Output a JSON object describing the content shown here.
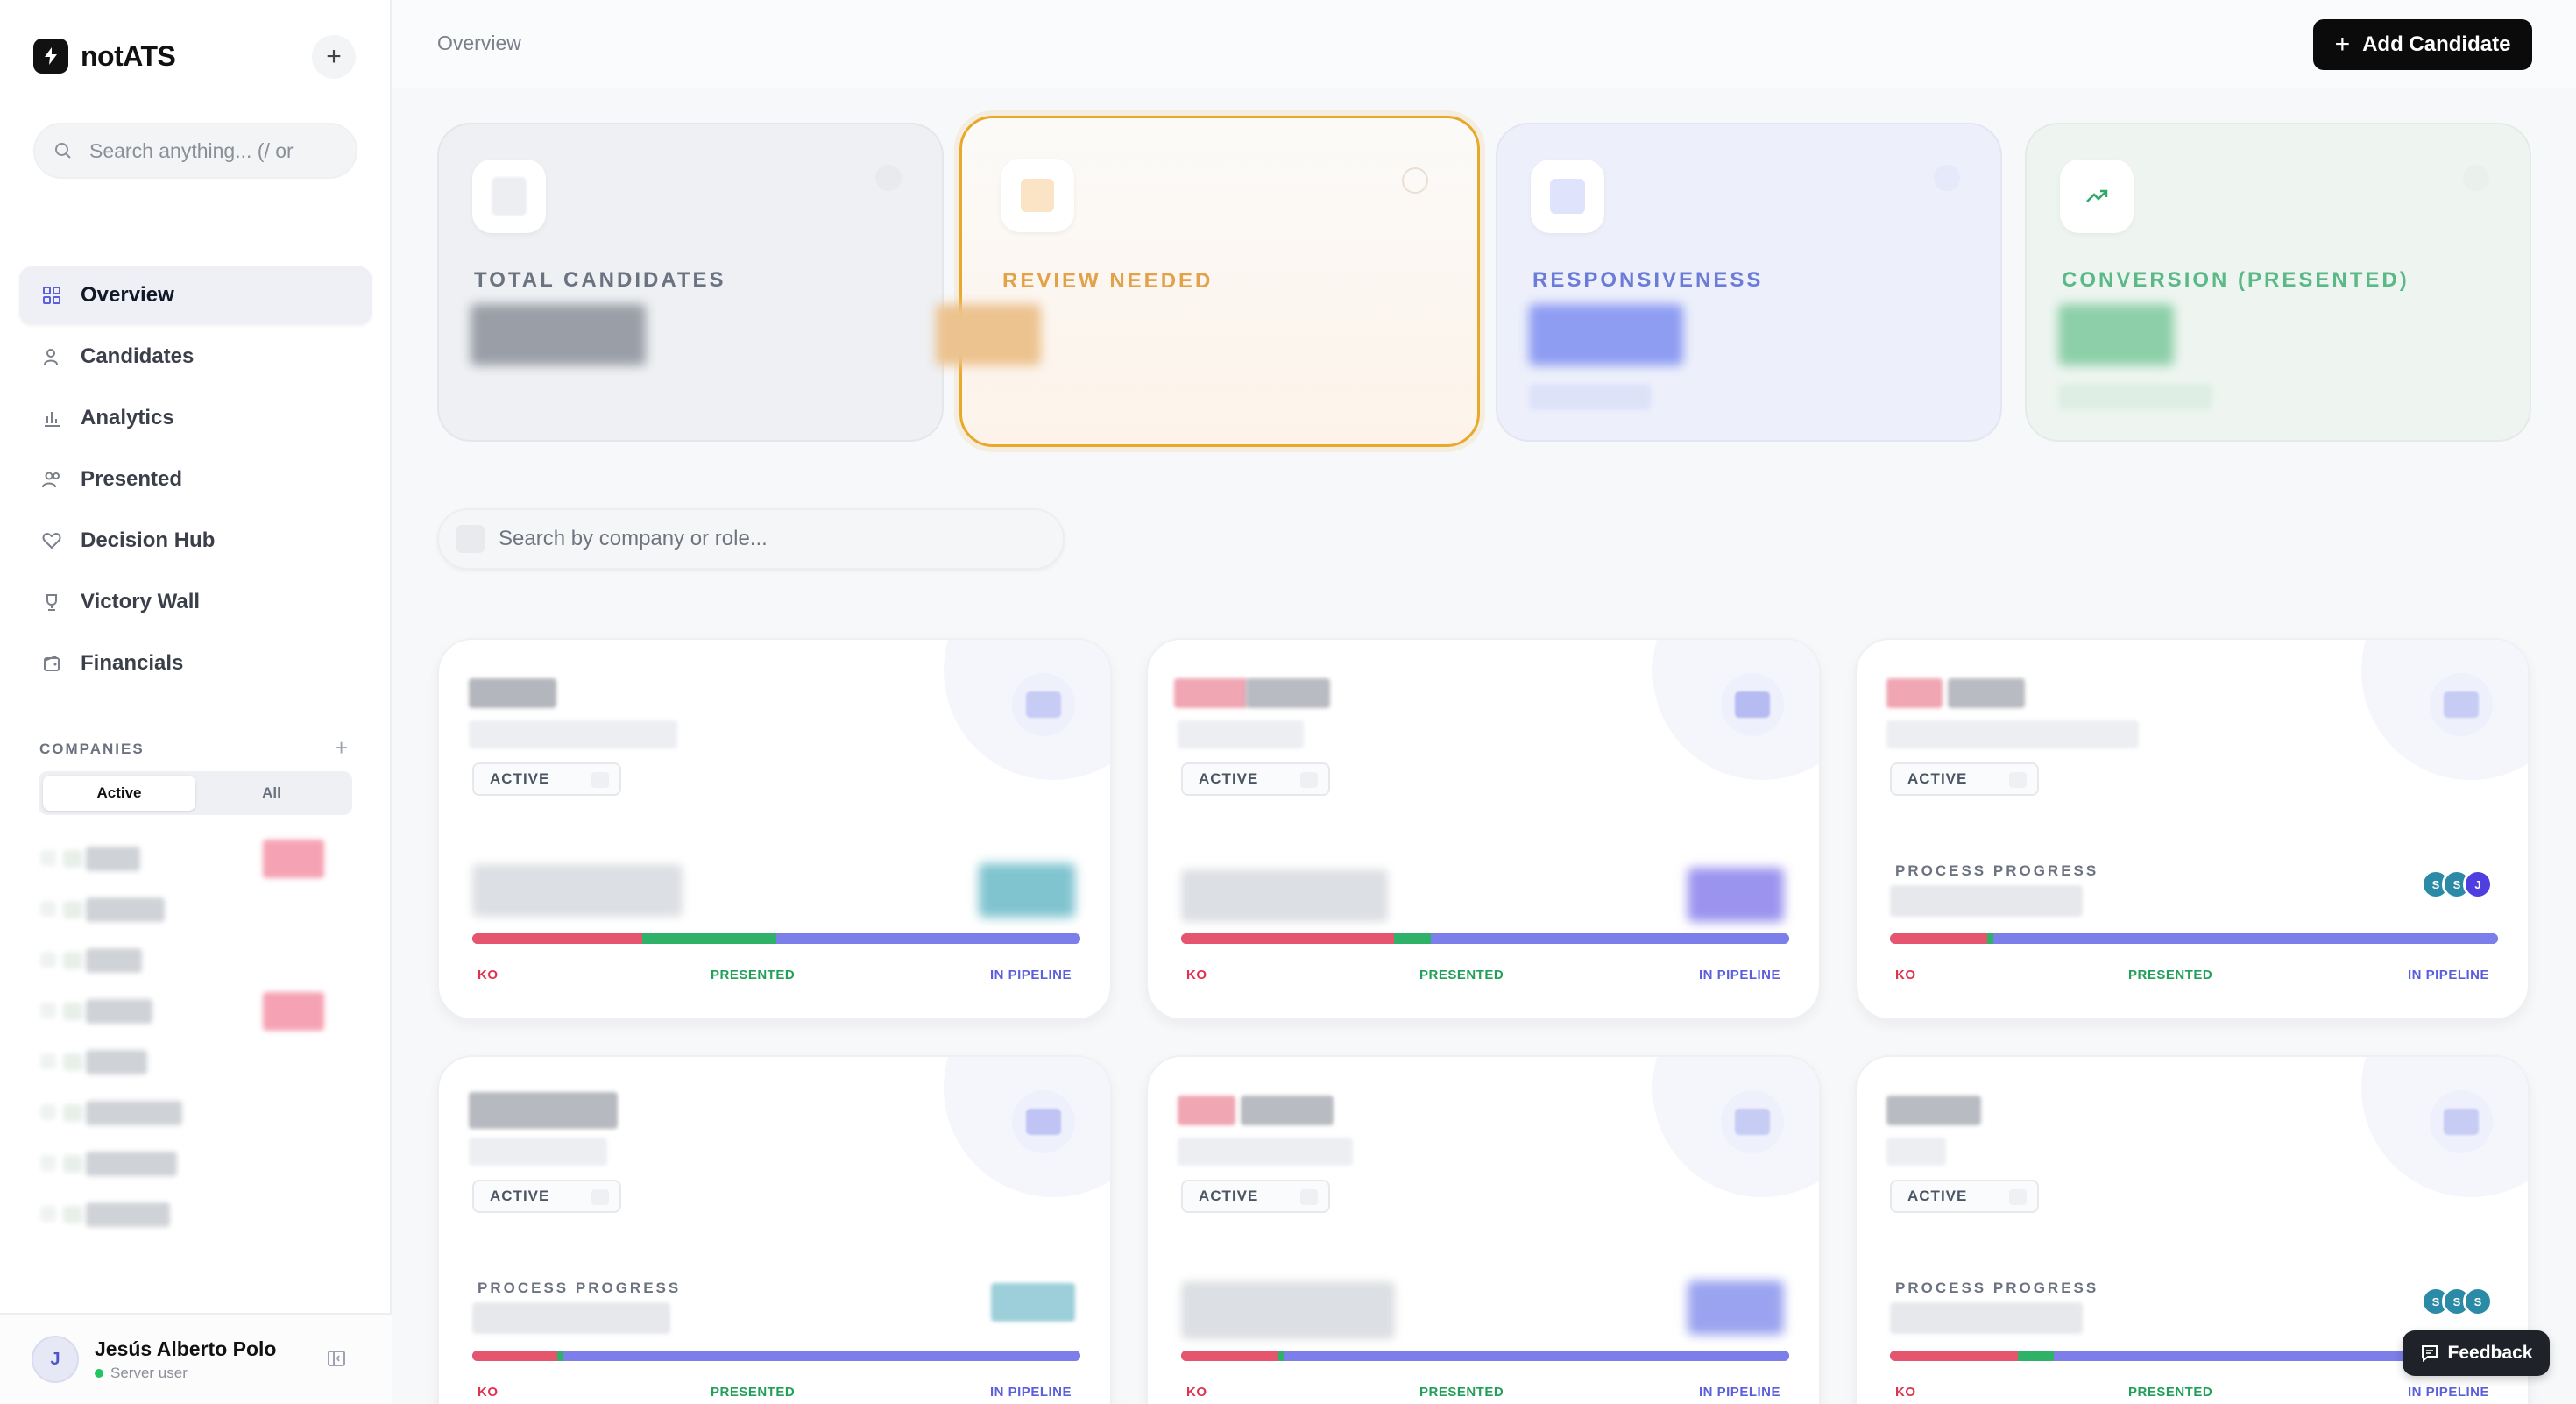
{
  "brand": {
    "name": "notATS"
  },
  "sidebar": {
    "search_placeholder": "Search anything... (/ or",
    "nav": [
      {
        "label": "Overview",
        "icon": "grid-icon",
        "active": true
      },
      {
        "label": "Candidates",
        "icon": "user-icon"
      },
      {
        "label": "Analytics",
        "icon": "bar-chart-icon"
      },
      {
        "label": "Presented",
        "icon": "users-icon"
      },
      {
        "label": "Decision Hub",
        "icon": "heart-icon"
      },
      {
        "label": "Victory Wall",
        "icon": "trophy-icon"
      },
      {
        "label": "Financials",
        "icon": "wallet-icon"
      }
    ],
    "companies_heading": "COMPANIES",
    "filter_active": "Active",
    "filter_all": "All"
  },
  "user": {
    "initial": "J",
    "name": "Jesús Alberto Polo",
    "role": "Server user"
  },
  "header": {
    "breadcrumb": "Overview",
    "add_button": "Add Candidate"
  },
  "stats": [
    {
      "label": "TOTAL CANDIDATES",
      "color": "#6b7280"
    },
    {
      "label": "REVIEW NEEDED",
      "color": "#e3a14a"
    },
    {
      "label": "RESPONSIVENESS",
      "color": "#6b7bd8"
    },
    {
      "label": "CONVERSION (PRESENTED)",
      "color": "#5ab987"
    }
  ],
  "company_search_placeholder": "Search by company or role...",
  "cards": [
    {
      "status": "ACTIVE",
      "legend_ko": "KO",
      "legend_presented": "PRESENTED",
      "legend_pipeline": "IN PIPELINE",
      "ko": 0.28,
      "presented": 0.22
    },
    {
      "status": "ACTIVE",
      "legend_ko": "KO",
      "legend_presented": "PRESENTED",
      "legend_pipeline": "IN PIPELINE",
      "ko": 0.35,
      "presented": 0.06
    },
    {
      "status": "ACTIVE",
      "process_label": "PROCESS PROGRESS",
      "avatars": [
        "S",
        "S",
        "J"
      ],
      "legend_ko": "KO",
      "legend_presented": "PRESENTED",
      "legend_pipeline": "IN PIPELINE",
      "ko": 0.16,
      "presented": 0.01
    },
    {
      "status": "ACTIVE",
      "process_label": "PROCESS PROGRESS",
      "legend_ko": "KO",
      "legend_presented": "PRESENTED",
      "legend_pipeline": "IN PIPELINE",
      "ko": 0.14,
      "presented": 0.01
    },
    {
      "status": "ACTIVE",
      "legend_ko": "KO",
      "legend_presented": "PRESENTED",
      "legend_pipeline": "IN PIPELINE",
      "ko": 0.16,
      "presented": 0.01
    },
    {
      "status": "ACTIVE",
      "process_label": "PROCESS PROGRESS",
      "avatars": [
        "S",
        "S",
        "S"
      ],
      "legend_ko": "KO",
      "legend_presented": "PRESENTED",
      "legend_pipeline": "IN PIPELINE",
      "ko": 0.21,
      "presented": 0.06
    }
  ],
  "feedback_label": "Feedback"
}
